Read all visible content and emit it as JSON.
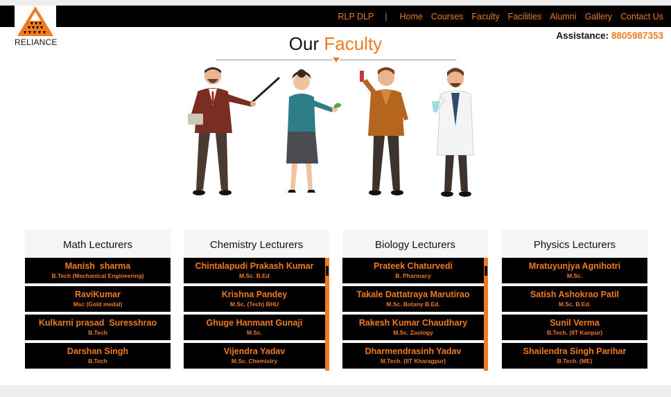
{
  "brand": {
    "logo_text": "RELIANCE"
  },
  "nav": {
    "program": "RLP DLP",
    "separator": "|",
    "links": [
      "Home",
      "Courses",
      "Faculty",
      "Facilities",
      "Alumni",
      "Gallery",
      "Contact Us"
    ]
  },
  "assistance": {
    "label": "Assistance:",
    "number": "8805987353"
  },
  "heading": {
    "prefix": "Our",
    "accent": "Faculty"
  },
  "colors": {
    "accent": "#f07a1f",
    "navbar": "#000000",
    "card": "#000000"
  },
  "columns": [
    {
      "title": "Math Lecturers",
      "faculty": [
        {
          "name": "Manish  sharma",
          "qual": "B.Tech (Mechanical Engineering)"
        },
        {
          "name": "RaviKumar",
          "qual": "Msc (Gold medal)"
        },
        {
          "name": "Kulkarni prasad  Suresshrao",
          "qual": "B.Tech"
        },
        {
          "name": "Darshan Singh",
          "qual": "B.Tech"
        }
      ]
    },
    {
      "title": "Chemistry Lecturers",
      "faculty": [
        {
          "name": "Chintalapudi Prakash Kumar",
          "qual": "M.Sc. B.Ed"
        },
        {
          "name": "Krishna Pandey",
          "qual": "M.Sc. (Tech) BHU"
        },
        {
          "name": "Ghuge Hanmant Gunaji",
          "qual": "M.Sc."
        },
        {
          "name": "Vijendra Yadav",
          "qual": "M.Sc. Chemistry"
        }
      ]
    },
    {
      "title": "Biology Lecturers",
      "faculty": [
        {
          "name": "Prateek Chaturvedi",
          "qual": "B. Pharmacy"
        },
        {
          "name": "Takale Dattatraya Marutirao",
          "qual": "M.Sc. Botany B.Ed."
        },
        {
          "name": "Rakesh Kumar Chaudhary",
          "qual": "M.Sc. Zoology"
        },
        {
          "name": "Dharmendrasinh Yadav",
          "qual": "M.Tech. (IIT Kharagpur)"
        }
      ]
    },
    {
      "title": "Physics Lecturers",
      "faculty": [
        {
          "name": "Mratuyunjya Agnihotri",
          "qual": "M.Sc."
        },
        {
          "name": "Satish Ashokrao Patil",
          "qual": "M.Sc. B.Ed."
        },
        {
          "name": "Sunil Verma",
          "qual": "B.Tech. (IIT Kanpur)"
        },
        {
          "name": "Shailendra Singh Parihar",
          "qual": "B.Tech. (ME)"
        }
      ]
    }
  ]
}
